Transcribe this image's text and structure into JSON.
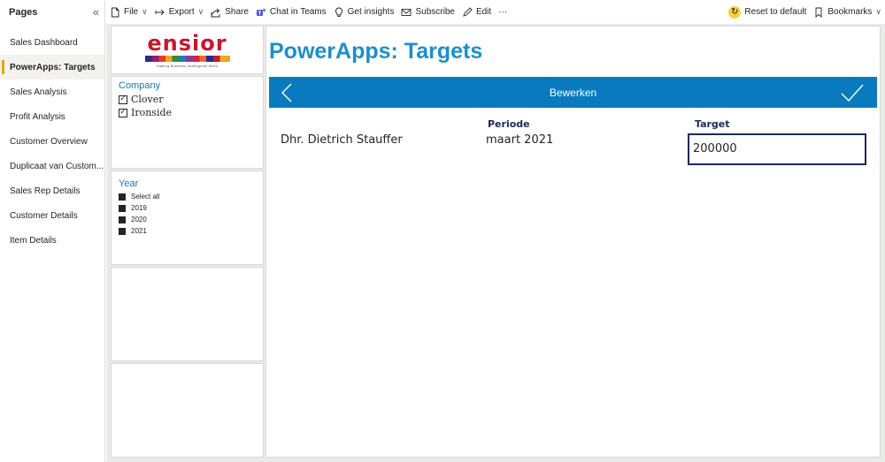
{
  "pages_pane": {
    "title": "Pages",
    "items": [
      {
        "label": "Sales Dashboard"
      },
      {
        "label": "PowerApps: Targets"
      },
      {
        "label": "Sales Analysis"
      },
      {
        "label": "Profit Analysis"
      },
      {
        "label": "Customer Overview"
      },
      {
        "label": "Duplicaat van Custom..."
      },
      {
        "label": "Sales Rep Details"
      },
      {
        "label": "Customer Details"
      },
      {
        "label": "Item Details"
      }
    ],
    "active_index": 1,
    "accent_color": "#e8a512"
  },
  "toolbar": {
    "file": "File",
    "export": "Export",
    "share": "Share",
    "chat_in_teams": "Chat in Teams",
    "get_insights": "Get insights",
    "subscribe": "Subscribe",
    "edit": "Edit",
    "more": "···",
    "reset": "Reset to default",
    "bookmarks": "Bookmarks"
  },
  "logo": {
    "word": "ensior",
    "tagline": "Making Business Intelligence Work"
  },
  "company_slicer": {
    "title": "Company",
    "options": [
      {
        "label": "Clover",
        "checked": true
      },
      {
        "label": "Ironside",
        "checked": true
      }
    ]
  },
  "year_slicer": {
    "title": "Year",
    "options": [
      {
        "label": "Select all"
      },
      {
        "label": "2019"
      },
      {
        "label": "2020"
      },
      {
        "label": "2021"
      }
    ]
  },
  "powerapp": {
    "title": "PowerApps: Targets",
    "bar_label": "Bewerken",
    "bar_color": "#0a7abf",
    "title_color": "#1b8fcc",
    "name": "Dhr. Dietrich Stauffer",
    "periode_label": "Periode",
    "periode_value": "maart 2021",
    "target_label": "Target",
    "target_value": "200000"
  }
}
